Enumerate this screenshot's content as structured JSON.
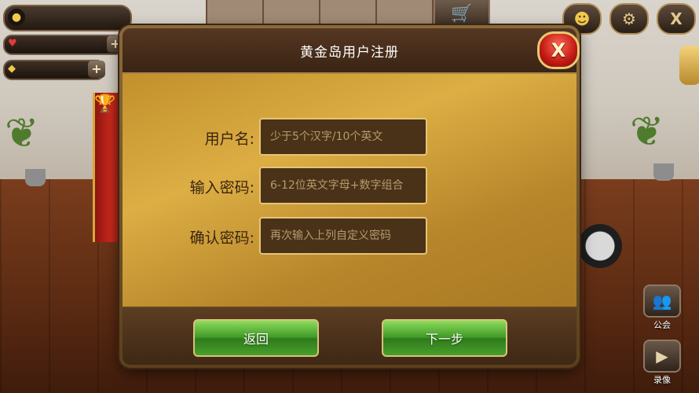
{
  "dialog": {
    "title": "黄金岛用户注册",
    "close_label": "X",
    "fields": [
      {
        "label": "用户名:",
        "placeholder": "少于5个汉字/10个英文"
      },
      {
        "label": "输入密码:",
        "placeholder": "6-12位英文字母+数字组合"
      },
      {
        "label": "确认密码:",
        "placeholder": "再次输入上列自定义密码"
      }
    ],
    "back_button": "返回",
    "next_button": "下一步"
  },
  "hud": {
    "plus_label": "+",
    "close_label": "X"
  },
  "side_buttons": {
    "guild_label": "公会",
    "record_label": "录像"
  },
  "icons": {
    "user": "user-icon",
    "heart": "heart-icon",
    "gold": "gold-icon",
    "cart": "cart-icon",
    "settings": "gear-icon",
    "close": "close-icon"
  }
}
